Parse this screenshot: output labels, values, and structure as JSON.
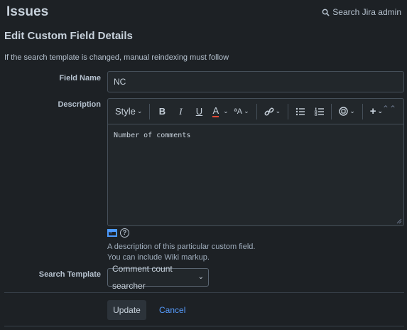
{
  "header": {
    "app_title": "Issues",
    "search_label": "Search Jira admin"
  },
  "page": {
    "title": "Edit Custom Field Details",
    "notice": "If the search template is changed, manual reindexing must follow"
  },
  "form": {
    "field_name": {
      "label": "Field Name",
      "value": "NC"
    },
    "description": {
      "label": "Description",
      "value": "Number of comments",
      "toolbar": {
        "style_label": "Style",
        "bold": "B",
        "italic": "I",
        "underline": "U",
        "text_color": "A",
        "more_formatting": "ªA"
      },
      "helper_lines": [
        "A description of this particular custom field.",
        "You can include Wiki markup."
      ]
    },
    "search_template": {
      "label": "Search Template",
      "selected": "Comment count searcher"
    }
  },
  "actions": {
    "update_label": "Update",
    "cancel_label": "Cancel"
  },
  "colors": {
    "background": "#1d2125",
    "link": "#579dff",
    "text_color_underline": "#e34935"
  }
}
